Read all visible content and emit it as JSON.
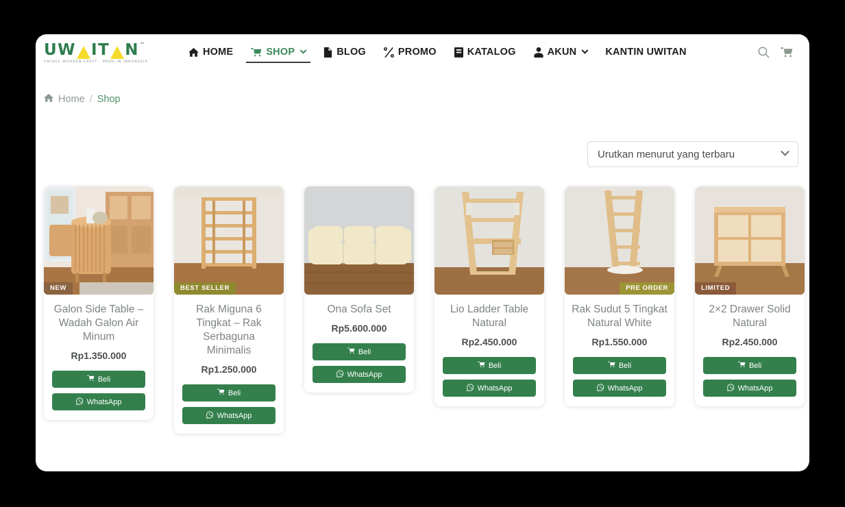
{
  "header": {
    "logo": {
      "word_left": "UW",
      "word_mid": "IT",
      "word_right": "N",
      "tm": "™",
      "tagline": "UNIQUE WOODEN CRAFT . MADE IN INDONESIA"
    },
    "nav": [
      {
        "label": "HOME",
        "icon": "home-icon",
        "active": false,
        "caret": false
      },
      {
        "label": "SHOP",
        "icon": "cart-icon",
        "active": true,
        "caret": true
      },
      {
        "label": "BLOG",
        "icon": "document-icon",
        "active": false,
        "caret": false
      },
      {
        "label": "PROMO",
        "icon": "percent-icon",
        "active": false,
        "caret": false
      },
      {
        "label": "KATALOG",
        "icon": "book-icon",
        "active": false,
        "caret": false
      },
      {
        "label": "AKUN",
        "icon": "user-icon",
        "active": false,
        "caret": true
      },
      {
        "label": "KANTIN UWITAN",
        "icon": "",
        "active": false,
        "caret": false
      }
    ],
    "tools": [
      {
        "name": "search-icon"
      },
      {
        "name": "cart-icon"
      }
    ],
    "accent_green": "#3c8a5d",
    "logo_green": "#2f7d4e",
    "logo_yellow": "#f5dc2a"
  },
  "breadcrumb": {
    "home_icon": "home-icon",
    "home_label": "Home",
    "separator": "/",
    "current": "Shop"
  },
  "sort": {
    "selected": "Urutkan menurut yang terbaru",
    "chevron": "chevron-down-icon"
  },
  "buttons": {
    "buy_label": "Beli",
    "whatsapp_label": "WhatsApp",
    "green": "#34804d"
  },
  "products": [
    {
      "title": "Galon Side Table – Wadah Galon Air Minum",
      "price": "Rp1.350.000",
      "badge": {
        "text": "NEW",
        "color": "#8a6340",
        "position": "left"
      },
      "image_alt": "wooden slatted round side table beside cabinet"
    },
    {
      "title": "Rak Miguna 6 Tingkat – Rak Serbaguna Minimalis",
      "price": "Rp1.250.000",
      "badge": {
        "text": "BEST SELLER",
        "color": "#8f8930",
        "position": "left"
      },
      "image_alt": "tall six tier wooden shelf rack"
    },
    {
      "title": "Ona Sofa Set",
      "price": "Rp5.600.000",
      "badge": null,
      "image_alt": "cream three seater sofa set"
    },
    {
      "title": "Lio Ladder Table Natural",
      "price": "Rp2.450.000",
      "badge": null,
      "image_alt": "ladder desk with shelves and drawer"
    },
    {
      "title": "Rak Sudut 5 Tingkat Natural White",
      "price": "Rp1.550.000",
      "badge": {
        "text": "PRE ORDER",
        "color": "#9c9435",
        "position": "right"
      },
      "image_alt": "five tier corner ladder shelf"
    },
    {
      "title": "2×2 Drawer Solid Natural",
      "price": "Rp2.450.000",
      "badge": {
        "text": "LIMITED",
        "color": "#8a5a3a",
        "position": "left"
      },
      "image_alt": "two by two cube drawer unit"
    }
  ]
}
